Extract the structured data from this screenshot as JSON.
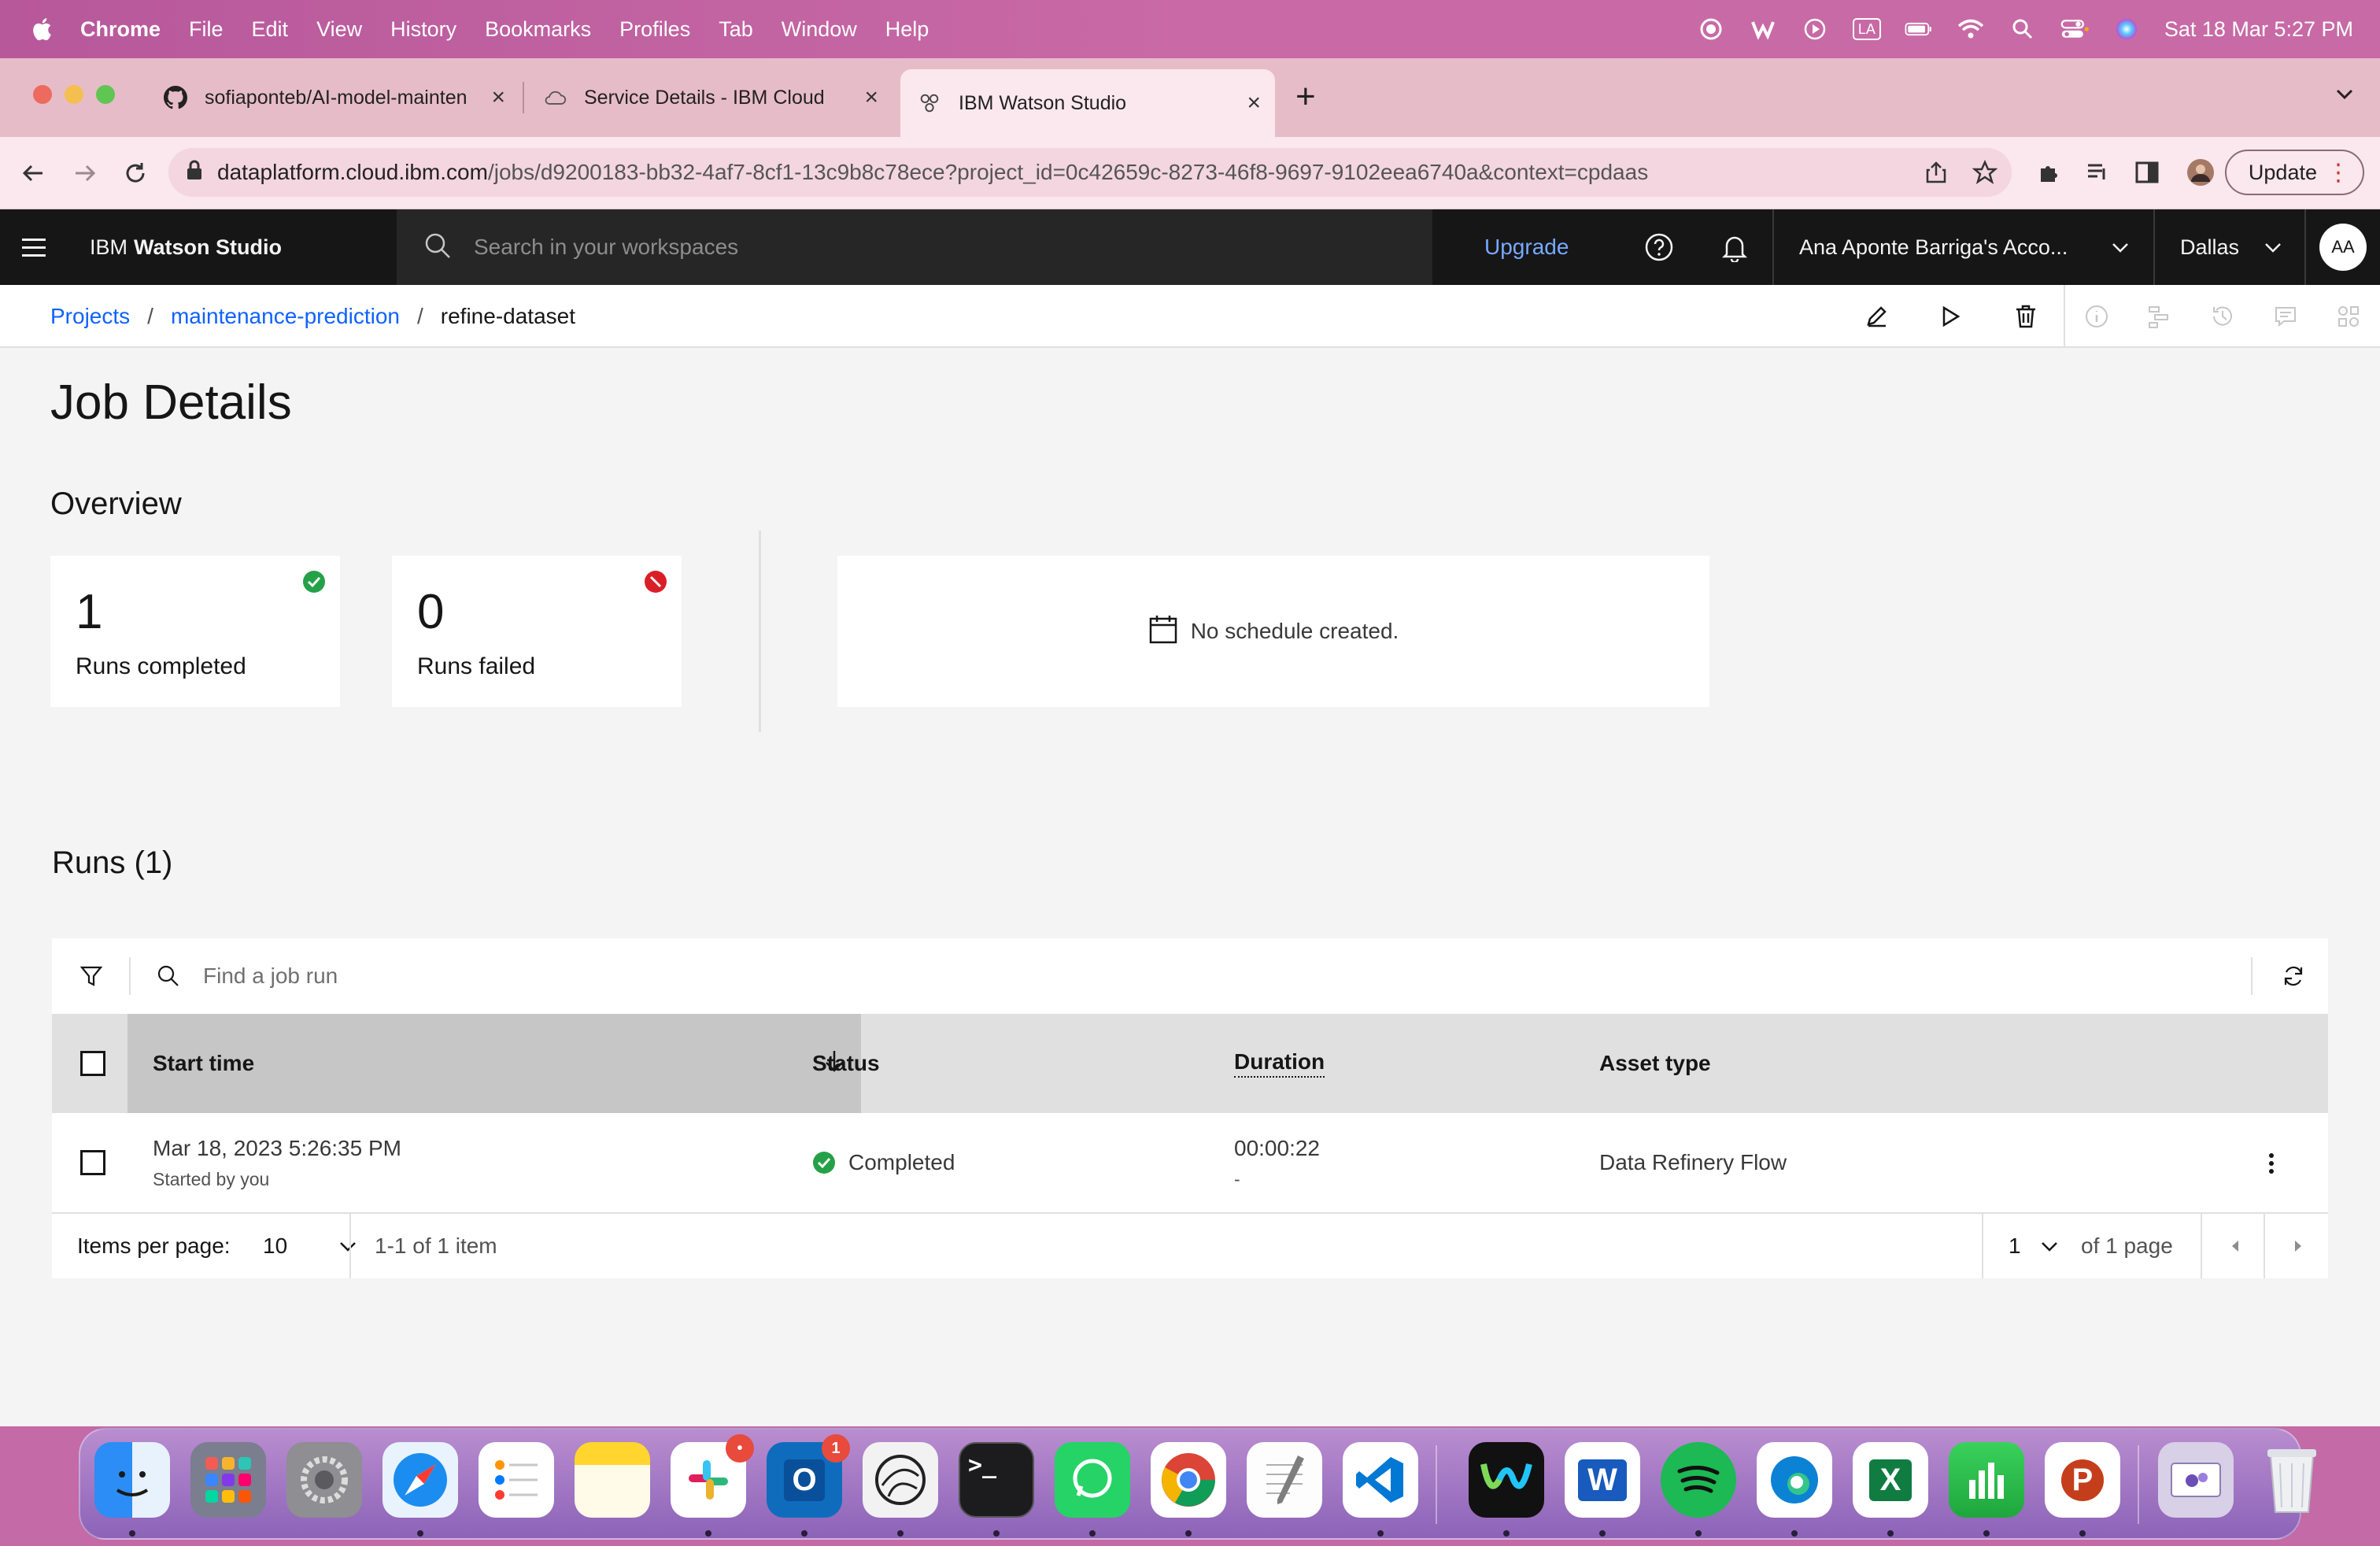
{
  "menubar": {
    "app": "Chrome",
    "items": [
      "File",
      "Edit",
      "View",
      "History",
      "Bookmarks",
      "Profiles",
      "Tab",
      "Window",
      "Help"
    ],
    "keyboard_layout": "LA",
    "datetime": "Sat 18 Mar  5:27 PM"
  },
  "browser": {
    "tabs": [
      {
        "title": "sofiaponteb/AI-model-mainten",
        "icon": "github-icon"
      },
      {
        "title": "Service Details - IBM Cloud",
        "icon": "ibm-cloud-icon"
      },
      {
        "title": "IBM Watson Studio",
        "icon": "watson-studio-icon",
        "active": true
      }
    ],
    "url_host": "dataplatform.cloud.ibm.com",
    "url_path": "/jobs/d9200183-bb32-4af7-8cf1-13c9b8c78ece?project_id=0c42659c-8273-46f8-9697-9102eea6740a&context=cpdaas",
    "update_label": "Update"
  },
  "header": {
    "product_prefix": "IBM",
    "product_name": "Watson Studio",
    "search_placeholder": "Search in your workspaces",
    "upgrade_label": "Upgrade",
    "account": "Ana Aponte Barriga's Acco...",
    "region": "Dallas",
    "avatar_initials": "AA"
  },
  "breadcrumb": {
    "items": [
      "Projects",
      "maintenance-prediction"
    ],
    "current": "refine-dataset"
  },
  "page": {
    "title": "Job Details",
    "overview_title": "Overview",
    "tiles": [
      {
        "value": "1",
        "label": "Runs completed",
        "status": "success"
      },
      {
        "value": "0",
        "label": "Runs failed",
        "status": "error"
      }
    ],
    "schedule_text": "No schedule created.",
    "runs_title": "Runs (1)"
  },
  "runs_table": {
    "search_placeholder": "Find a job run",
    "columns": [
      "Start time",
      "Status",
      "Duration",
      "Asset type"
    ],
    "rows": [
      {
        "start_time": "Mar 18, 2023 5:26:35 PM",
        "started_by": "Started by you",
        "status": "Completed",
        "duration": "00:00:22",
        "duration_sub": "-",
        "asset_type": "Data Refinery Flow"
      }
    ],
    "pagination": {
      "items_per_page_label": "Items per page:",
      "items_per_page": "10",
      "range": "1-1 of 1 item",
      "page": "1",
      "page_total": "of 1 page"
    }
  },
  "colors": {
    "accent_link": "#0f62fe",
    "success": "#24a148",
    "error": "#da1e28",
    "header_bg": "#161616"
  },
  "dock": {
    "apps": [
      {
        "name": "finder-icon",
        "badge": ""
      },
      {
        "name": "launchpad-icon",
        "badge": ""
      },
      {
        "name": "system-settings-icon",
        "badge": ""
      },
      {
        "name": "safari-icon",
        "badge": ""
      },
      {
        "name": "reminders-icon",
        "badge": ""
      },
      {
        "name": "notes-icon",
        "badge": ""
      },
      {
        "name": "slack-icon",
        "badge": "•"
      },
      {
        "name": "outlook-icon",
        "badge": "1"
      },
      {
        "name": "davinci-icon",
        "badge": ""
      },
      {
        "name": "terminal-icon",
        "badge": ""
      },
      {
        "name": "whatsapp-icon",
        "badge": ""
      },
      {
        "name": "chrome-icon",
        "badge": ""
      },
      {
        "name": "textedit-icon",
        "badge": ""
      },
      {
        "name": "vscode-icon",
        "badge": ""
      },
      {
        "name": "webex-icon",
        "badge": ""
      },
      {
        "name": "word-icon",
        "badge": ""
      },
      {
        "name": "spotify-icon",
        "badge": ""
      },
      {
        "name": "edge-icon",
        "badge": ""
      },
      {
        "name": "excel-icon",
        "badge": ""
      },
      {
        "name": "numbers-icon",
        "badge": ""
      },
      {
        "name": "powerpoint-icon",
        "badge": ""
      },
      {
        "name": "downloads-stack-icon",
        "badge": ""
      },
      {
        "name": "trash-icon",
        "badge": ""
      }
    ]
  }
}
